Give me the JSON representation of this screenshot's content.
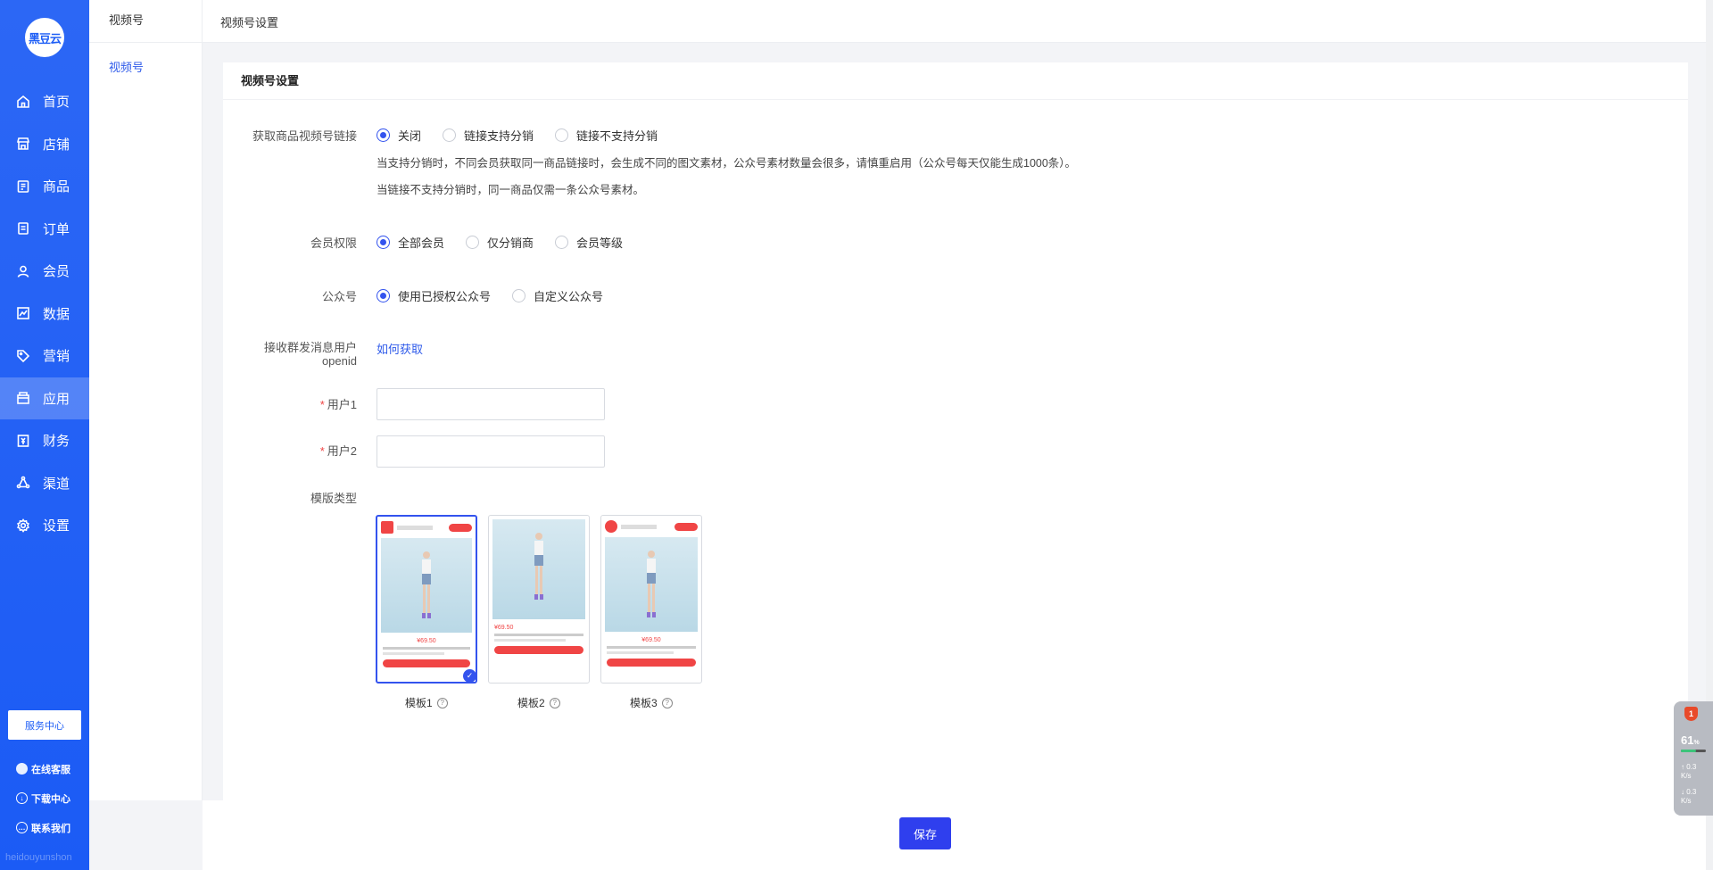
{
  "brand": {
    "logo_text": "黑豆云",
    "watermark": "heidouyunshon",
    "accent": "#1f5ff6"
  },
  "nav": {
    "items": [
      {
        "label": "首页",
        "icon": "home-icon"
      },
      {
        "label": "店铺",
        "icon": "shop-icon"
      },
      {
        "label": "商品",
        "icon": "goods-icon"
      },
      {
        "label": "订单",
        "icon": "order-icon"
      },
      {
        "label": "会员",
        "icon": "user-icon"
      },
      {
        "label": "数据",
        "icon": "chart-icon"
      },
      {
        "label": "营销",
        "icon": "tag-icon"
      },
      {
        "label": "应用",
        "icon": "app-icon"
      },
      {
        "label": "财务",
        "icon": "finance-icon"
      },
      {
        "label": "渠道",
        "icon": "channel-icon"
      },
      {
        "label": "设置",
        "icon": "gear-icon"
      }
    ],
    "active_index": 7,
    "service_center": "服务中心",
    "footer": [
      {
        "label": "在线客服",
        "icon": "avatar-icon"
      },
      {
        "label": "下载中心",
        "icon": "download-icon"
      },
      {
        "label": "联系我们",
        "icon": "chat-icon"
      }
    ]
  },
  "subnav": {
    "title": "视频号",
    "items": [
      "视频号"
    ]
  },
  "header": {
    "breadcrumb": "视频号设置"
  },
  "panel": {
    "title": "视频号设置",
    "link_setting": {
      "label": "获取商品视频号链接",
      "options": [
        "关闭",
        "链接支持分销",
        "链接不支持分销"
      ],
      "selected": 0,
      "hints": [
        "当支持分销时，不同会员获取同一商品链接时，会生成不同的图文素材，公众号素材数量会很多，请慎重启用（公众号每天仅能生成1000条）。",
        "当链接不支持分销时，同一商品仅需一条公众号素材。"
      ]
    },
    "member_permission": {
      "label": "会员权限",
      "options": [
        "全部会员",
        "仅分销商",
        "会员等级"
      ],
      "selected": 0
    },
    "official_account": {
      "label": "公众号",
      "options": [
        "使用已授权公众号",
        "自定义公众号"
      ],
      "selected": 0
    },
    "openid": {
      "label_line1": "接收群发消息用户",
      "label_line2": "openid",
      "link": "如何获取"
    },
    "user1": {
      "label": "用户1",
      "value": ""
    },
    "user2": {
      "label": "用户2",
      "value": ""
    },
    "template": {
      "label": "模版类型",
      "items": [
        {
          "name": "模板1",
          "price": "¥69.50"
        },
        {
          "name": "模板2",
          "price": "¥69.50"
        },
        {
          "name": "模板3",
          "price": "¥69.50"
        }
      ],
      "selected": 0
    }
  },
  "footer": {
    "save_label": "保存"
  },
  "widget": {
    "badge": "1",
    "percent": "61",
    "percent_unit": "%",
    "up": "0.3",
    "down": "0.3",
    "unit": "K/s"
  }
}
